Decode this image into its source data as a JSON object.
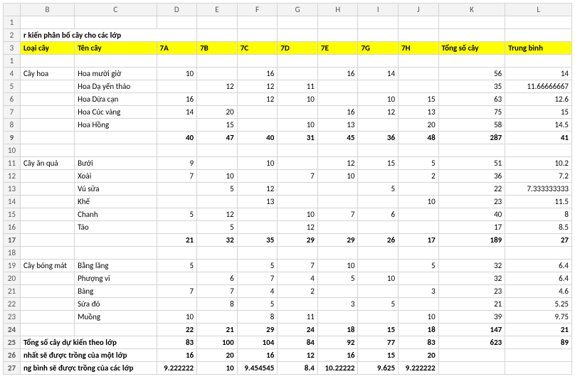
{
  "colHeaders": [
    "",
    "B",
    "C",
    "D",
    "E",
    "F",
    "G",
    "H",
    "I",
    "J",
    "K",
    "L"
  ],
  "title": "r kiến phân bố cây cho các lớp",
  "headerRow": [
    "Loại cây",
    "Tên cây",
    "7A",
    "7B",
    "7C",
    "7D",
    "7E",
    "7G",
    "7H",
    "Tổng số cây",
    "Trung bình"
  ],
  "rows": [
    {
      "n": "1",
      "cells": [
        "",
        "",
        "",
        "",
        "",
        "",
        "",
        "",
        "",
        "",
        ""
      ]
    },
    {
      "n": "4",
      "cells": [
        "Cây hoa",
        "Hoa mười giờ",
        "10",
        "",
        "16",
        "",
        "16",
        "14",
        "",
        "56",
        "14"
      ]
    },
    {
      "n": "5",
      "cells": [
        "",
        "Hoa Dạ yến thảo",
        "",
        "12",
        "12",
        "11",
        "",
        "",
        "",
        "35",
        "11.66666667"
      ]
    },
    {
      "n": "6",
      "cells": [
        "",
        "Hoa Dừa cạn",
        "16",
        "",
        "12",
        "10",
        "",
        "10",
        "15",
        "63",
        "12.6"
      ]
    },
    {
      "n": "7",
      "cells": [
        "",
        "Hoa Cúc vàng",
        "14",
        "20",
        "",
        "",
        "16",
        "12",
        "13",
        "75",
        "15"
      ]
    },
    {
      "n": "8",
      "cells": [
        "",
        "Hoa Hồng",
        "",
        "15",
        "",
        "10",
        "13",
        "",
        "20",
        "58",
        "14.5"
      ]
    },
    {
      "n": "9",
      "cells": [
        "",
        "",
        "40",
        "47",
        "40",
        "31",
        "45",
        "36",
        "48",
        "287",
        "41"
      ],
      "bold": true
    },
    {
      "n": "10",
      "cells": [
        "",
        "",
        "",
        "",
        "",
        "",
        "",
        "",
        "",
        "",
        ""
      ]
    },
    {
      "n": "11",
      "cells": [
        "Cây ăn quả",
        "Bưởi",
        "9",
        "",
        "10",
        "",
        "12",
        "15",
        "5",
        "51",
        "10.2"
      ]
    },
    {
      "n": "12",
      "cells": [
        "",
        "Xoài",
        "7",
        "10",
        "",
        "7",
        "10",
        "",
        "2",
        "36",
        "7.2"
      ]
    },
    {
      "n": "13",
      "cells": [
        "",
        "Vú sữa",
        "",
        "5",
        "12",
        "",
        "",
        "5",
        "",
        "22",
        "7.333333333"
      ]
    },
    {
      "n": "14",
      "cells": [
        "",
        "Khế",
        "",
        "",
        "13",
        "",
        "",
        "",
        "10",
        "23",
        "11.5"
      ]
    },
    {
      "n": "15",
      "cells": [
        "",
        "Chanh",
        "5",
        "12",
        "",
        "10",
        "7",
        "6",
        "",
        "40",
        "8"
      ]
    },
    {
      "n": "16",
      "cells": [
        "",
        "Táo",
        "",
        "5",
        "",
        "12",
        "",
        "",
        "",
        "17",
        "8.5"
      ]
    },
    {
      "n": "17",
      "cells": [
        "",
        "",
        "21",
        "32",
        "35",
        "29",
        "29",
        "26",
        "17",
        "189",
        "27"
      ],
      "bold": true
    },
    {
      "n": "18",
      "cells": [
        "",
        "",
        "",
        "",
        "",
        "",
        "",
        "",
        "",
        "",
        ""
      ]
    },
    {
      "n": "19",
      "cells": [
        "Cây bóng mát",
        "Bằng lăng",
        "5",
        "",
        "5",
        "7",
        "10",
        "",
        "5",
        "32",
        "6.4"
      ]
    },
    {
      "n": "20",
      "cells": [
        "",
        "Phượng vĩ",
        "",
        "6",
        "7",
        "4",
        "5",
        "10",
        "",
        "32",
        "6.4"
      ]
    },
    {
      "n": "21",
      "cells": [
        "",
        "Bàng",
        "7",
        "7",
        "4",
        "2",
        "",
        "",
        "3",
        "23",
        "4.6"
      ]
    },
    {
      "n": "22",
      "cells": [
        "",
        "Sửa đỏ",
        "",
        "8",
        "5",
        "",
        "3",
        "5",
        "",
        "21",
        "5.25"
      ]
    },
    {
      "n": "23",
      "cells": [
        "",
        "Muồng",
        "10",
        "",
        "8",
        "11",
        "",
        "",
        "10",
        "39",
        "9.75"
      ]
    },
    {
      "n": "24",
      "cells": [
        "",
        "",
        "22",
        "21",
        "29",
        "24",
        "18",
        "15",
        "18",
        "147",
        "21"
      ],
      "bold": true
    }
  ],
  "summary": [
    {
      "n": "25",
      "label": "Tổng số cây dự kiến theo lớp",
      "cells": [
        "83",
        "100",
        "104",
        "84",
        "92",
        "77",
        "83",
        "623",
        "89"
      ],
      "bold": true
    },
    {
      "n": "26",
      "label": "nhất sẽ được trồng của một lớp",
      "cells": [
        "16",
        "20",
        "16",
        "12",
        "16",
        "15",
        "20",
        "",
        ""
      ],
      "bold": true
    },
    {
      "n": "27",
      "label": "ng bình sẽ được trồng của các lớp",
      "cells": [
        "9.222222",
        "10",
        "9.454545",
        "8.4",
        "10.22222",
        "9.625",
        "9.222222",
        "",
        ""
      ],
      "bold": true
    }
  ]
}
